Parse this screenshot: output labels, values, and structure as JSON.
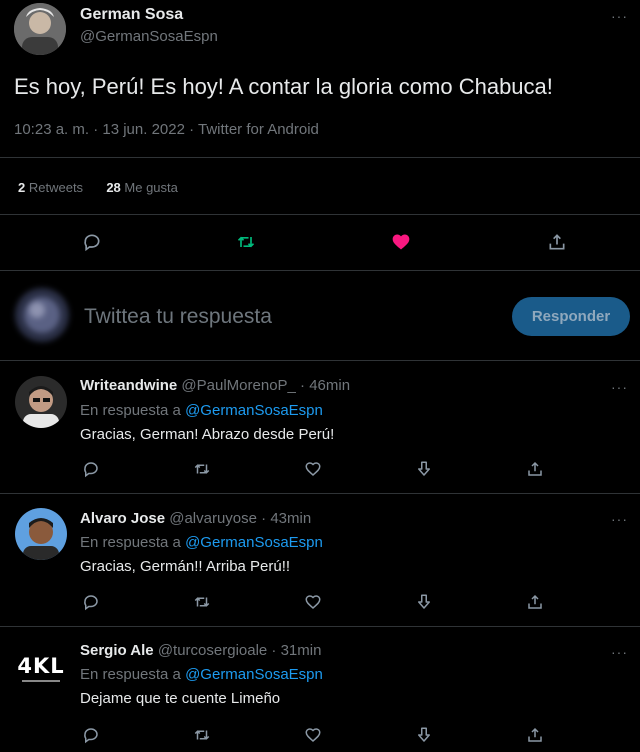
{
  "tweet": {
    "author_name": "German Sosa",
    "author_handle": "@GermanSosaEspn",
    "text": "Es hoy, Perú! Es hoy! A contar la gloria como Chabuca!",
    "meta": "10:23 a. m. · 13 jun. 2022 · Twitter for Android",
    "retweets_count": "2",
    "retweets_label": "Retweets",
    "likes_count": "28",
    "likes_label": "Me gusta",
    "more": "···"
  },
  "compose": {
    "placeholder": "Twittea tu respuesta",
    "button_label": "Responder"
  },
  "replies": [
    {
      "name": "Writeandwine",
      "handle_time": "@PaulMorenoP_ · 46min",
      "reply_to_label": "En respuesta a",
      "reply_to_handle": "@GermanSosaEspn",
      "text": "Gracias, German! Abrazo desde Perú!",
      "more": "···"
    },
    {
      "name": "Alvaro Jose",
      "handle_time": "@alvaruyose · 43min",
      "reply_to_label": "En respuesta a",
      "reply_to_handle": "@GermanSosaEspn",
      "text": "Gracias, Germán!! Arriba Perú!!",
      "more": "···"
    },
    {
      "name": "Sergio Ale",
      "handle_time": "@turcosergioale · 31min",
      "reply_to_label": "En respuesta a",
      "reply_to_handle": "@GermanSosaEspn",
      "text": "Dejame que te cuente Limeño",
      "more": "···",
      "avatar_logo": "4KL"
    }
  ],
  "colors": {
    "background": "#000000",
    "retweet_green": "#00ba7c",
    "like_pink": "#f91880",
    "link_blue": "#1d9bf0",
    "button_blue": "#1a5b8a"
  }
}
